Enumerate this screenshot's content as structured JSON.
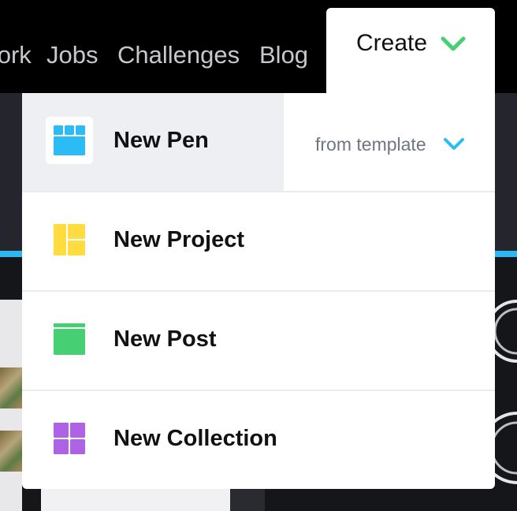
{
  "nav": {
    "links": [
      "Work",
      "Jobs",
      "Challenges",
      "Blog"
    ],
    "create_label": "Create"
  },
  "dropdown": {
    "items": [
      {
        "label": "New Pen",
        "icon": "pen-grid-icon",
        "color": "#2bbcf5",
        "secondary_label": "from template"
      },
      {
        "label": "New Project",
        "icon": "project-layout-icon",
        "color": "#ffdd40"
      },
      {
        "label": "New Post",
        "icon": "post-icon",
        "color": "#47cf73"
      },
      {
        "label": "New Collection",
        "icon": "collection-grid-icon",
        "color": "#ae63e4"
      }
    ]
  },
  "colors": {
    "accent_green": "#47cf73",
    "accent_blue": "#2bbcf5",
    "nav_bg": "#000000",
    "menu_hover": "#eeeff3"
  }
}
